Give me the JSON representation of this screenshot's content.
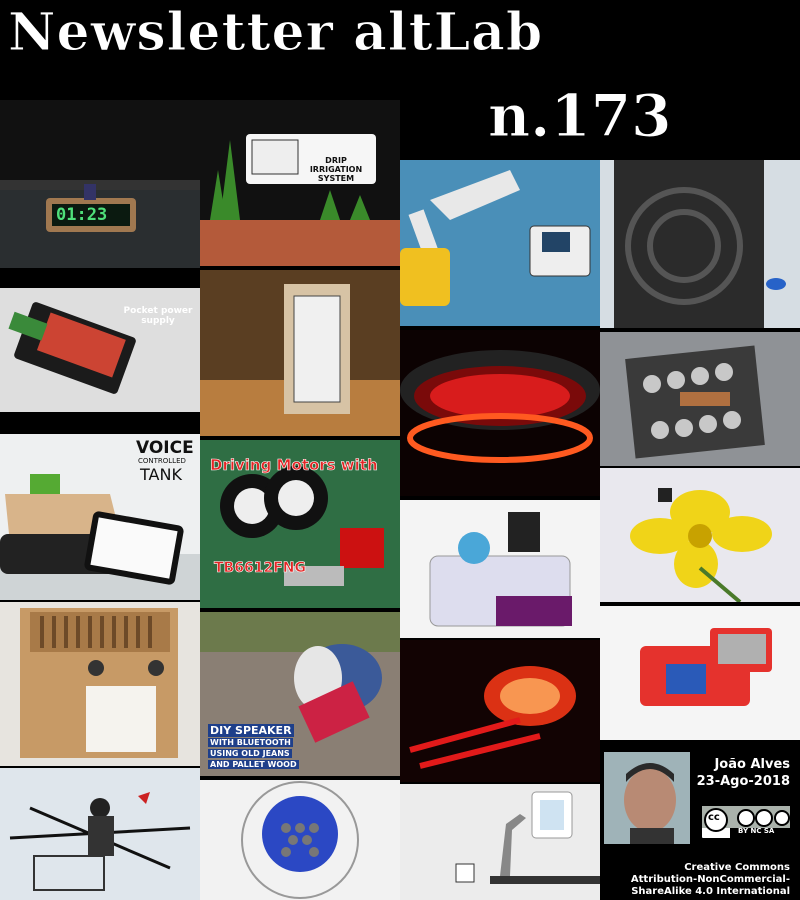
{
  "header": {
    "title": "Newsletter altLab",
    "issue": "n.173"
  },
  "tiles": {
    "clock_text": "01:23",
    "drip_label": "DRIP IRRIGATION SYSTEM",
    "power_label": "Pocket power supply",
    "voice_label_1": "VOICE",
    "voice_label_2": "CONTROLLED",
    "voice_label_3": "TANK",
    "motors_label_1": "Driving Motors with",
    "motors_label_2": "TB6612FNG",
    "speaker_label_1": "DIY SPEAKER",
    "speaker_label_2": "WITH BLUETOOTH",
    "speaker_label_3": "USING OLD JEANS",
    "speaker_label_4": "AND PALLET WOOD"
  },
  "footer": {
    "author": "João Alves",
    "date": "23-Ago-2018",
    "license_1": "Creative Commons",
    "license_2": "Attribution-NonCommercial-",
    "license_3": "ShareAlike 4.0 International",
    "cc_badge": "BY NC SA"
  },
  "colors": {
    "background": "#000000",
    "title": "#ffffff",
    "accent_red": "#d8262b",
    "accent_orange": "#ff6a00"
  }
}
